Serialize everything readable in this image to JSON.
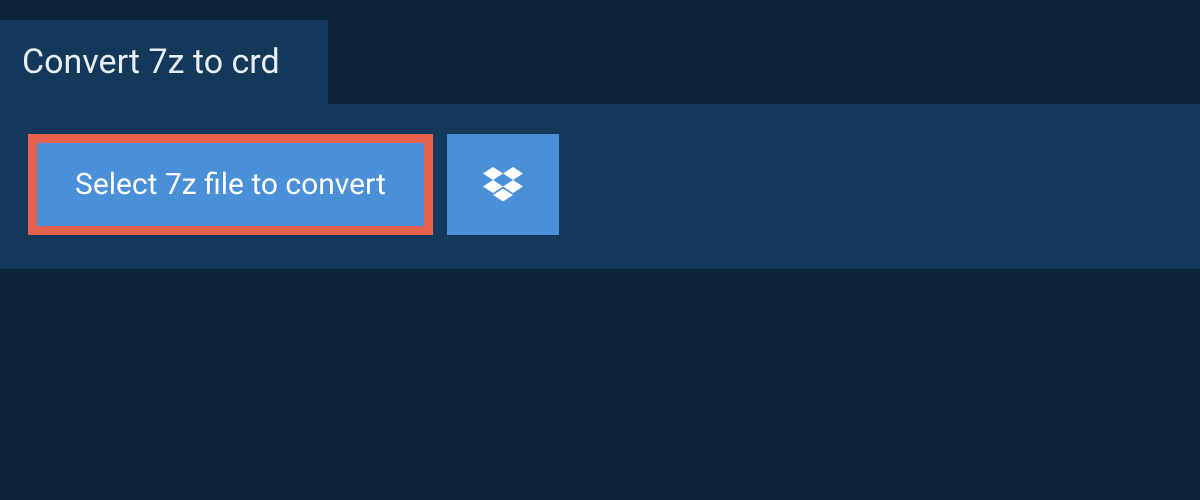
{
  "header": {
    "title": "Convert 7z to crd"
  },
  "actions": {
    "select_label": "Select 7z file to convert"
  }
}
